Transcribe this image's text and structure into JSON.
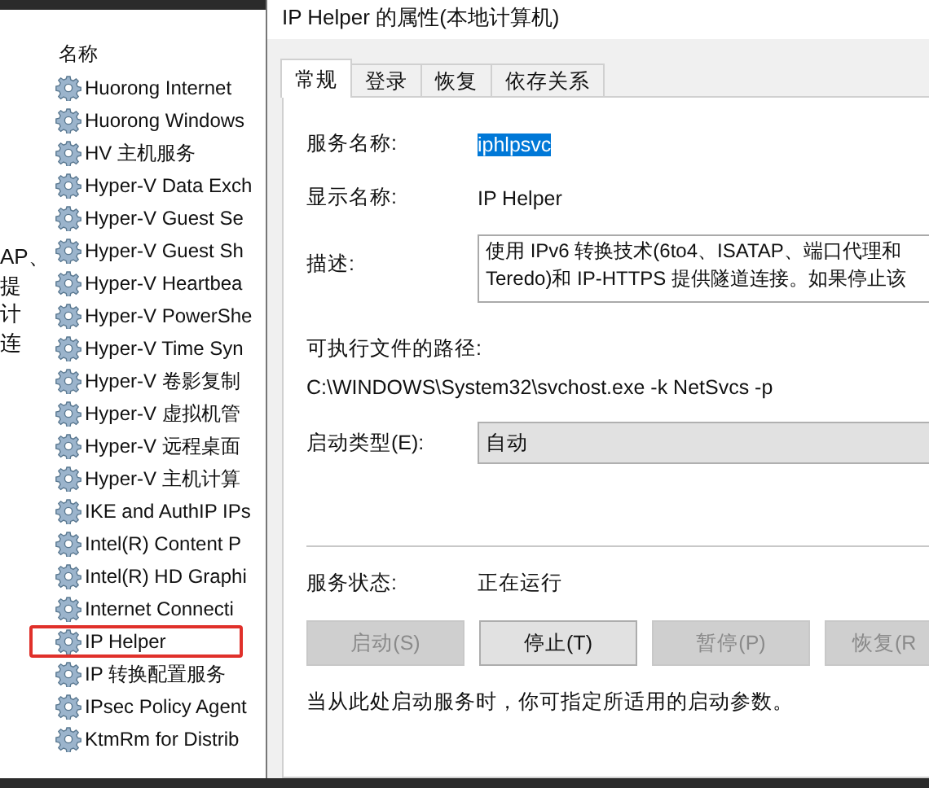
{
  "background_text": [
    "AP、",
    "提",
    "计",
    "连"
  ],
  "services_list": {
    "column_header": "名称",
    "items": [
      {
        "name": "Huorong Internet",
        "highlighted": false
      },
      {
        "name": "Huorong Windows",
        "highlighted": false
      },
      {
        "name": "HV 主机服务",
        "highlighted": false
      },
      {
        "name": "Hyper-V Data Exch",
        "highlighted": false
      },
      {
        "name": "Hyper-V Guest Se",
        "highlighted": false
      },
      {
        "name": "Hyper-V Guest Sh",
        "highlighted": false
      },
      {
        "name": "Hyper-V Heartbea",
        "highlighted": false
      },
      {
        "name": "Hyper-V PowerShe",
        "highlighted": false
      },
      {
        "name": "Hyper-V Time Syn",
        "highlighted": false
      },
      {
        "name": "Hyper-V 卷影复制",
        "highlighted": false
      },
      {
        "name": "Hyper-V 虚拟机管",
        "highlighted": false
      },
      {
        "name": "Hyper-V 远程桌面",
        "highlighted": false
      },
      {
        "name": "Hyper-V 主机计算",
        "highlighted": false
      },
      {
        "name": "IKE and AuthIP IPs",
        "highlighted": false
      },
      {
        "name": "Intel(R) Content P",
        "highlighted": false
      },
      {
        "name": "Intel(R) HD Graphi",
        "highlighted": false
      },
      {
        "name": "Internet Connecti",
        "highlighted": false
      },
      {
        "name": "IP Helper",
        "highlighted": true
      },
      {
        "name": "IP 转换配置服务",
        "highlighted": false
      },
      {
        "name": "IPsec Policy Agent",
        "highlighted": false
      },
      {
        "name": "KtmRm for Distrib",
        "highlighted": false
      }
    ]
  },
  "dialog": {
    "title": "IP Helper 的属性(本地计算机)",
    "tabs": [
      {
        "label": "常规",
        "selected": true
      },
      {
        "label": "登录",
        "selected": false
      },
      {
        "label": "恢复",
        "selected": false
      },
      {
        "label": "依存关系",
        "selected": false
      }
    ],
    "service_name": {
      "label": "服务名称:",
      "value": "iphlpsvc",
      "selected": true
    },
    "display_name": {
      "label": "显示名称:",
      "value": "IP Helper"
    },
    "description": {
      "label": "描述:",
      "lines": [
        "使用 IPv6 转换技术(6to4、ISATAP、端口代理和",
        "Teredo)和 IP-HTTPS 提供隧道连接。如果停止该"
      ]
    },
    "executable_path": {
      "label": "可执行文件的路径:",
      "value": "C:\\WINDOWS\\System32\\svchost.exe -k NetSvcs -p"
    },
    "startup_type": {
      "label": "启动类型(E):",
      "value": "自动"
    },
    "service_status": {
      "label": "服务状态:",
      "value": "正在运行"
    },
    "buttons": [
      {
        "label": "启动(S)",
        "disabled": true
      },
      {
        "label": "停止(T)",
        "disabled": false
      },
      {
        "label": "暂停(P)",
        "disabled": true
      },
      {
        "label": "恢复(R",
        "disabled": true
      }
    ],
    "hint": "当从此处启动服务时，你可指定所适用的启动参数。"
  }
}
